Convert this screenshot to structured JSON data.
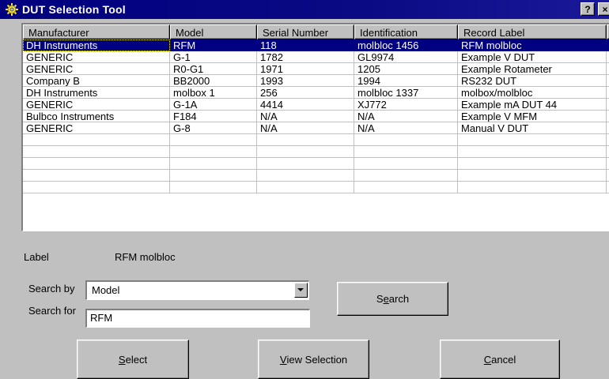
{
  "window": {
    "title": "DUT Selection Tool",
    "help_label": "?",
    "close_label": "×"
  },
  "table": {
    "columns": [
      "Manufacturer",
      "Model",
      "Serial Number",
      "Identification",
      "Record Label",
      ""
    ],
    "selected_index": 0,
    "rows": [
      [
        "DH Instruments",
        "RFM",
        "118",
        "molbloc 1456",
        "RFM molbloc"
      ],
      [
        "GENERIC",
        "G-1",
        "1782",
        "GL9974",
        "Example V DUT"
      ],
      [
        "GENERIC",
        "R0-G1",
        "1971",
        "1205",
        "Example Rotameter"
      ],
      [
        "Company B",
        "BB2000",
        "1993",
        "1994",
        "RS232 DUT"
      ],
      [
        "DH Instruments",
        "molbox 1",
        "256",
        "molbloc 1337",
        "molbox/molbloc"
      ],
      [
        "GENERIC",
        "G-1A",
        "4414",
        "XJ772",
        "Example mA DUT 44"
      ],
      [
        "Bulbco Instruments",
        "F184",
        "N/A",
        "N/A",
        "Example V MFM"
      ],
      [
        "GENERIC",
        "G-8",
        "N/A",
        "N/A",
        "Manual V DUT"
      ],
      [
        "",
        "",
        "",
        "",
        ""
      ],
      [
        "",
        "",
        "",
        "",
        ""
      ],
      [
        "",
        "",
        "",
        "",
        ""
      ],
      [
        "",
        "",
        "",
        "",
        ""
      ],
      [
        "",
        "",
        "",
        "",
        ""
      ]
    ]
  },
  "label": {
    "caption": "Label",
    "value": "RFM molbloc"
  },
  "search": {
    "by_label": "Search by",
    "by_value": "Model",
    "for_label": "Search for",
    "for_value": "RFM",
    "button_prefix": "S",
    "button_mnemonic": "e",
    "button_suffix": "arch"
  },
  "buttons": {
    "select_mnemonic": "S",
    "select_rest": "elect",
    "view_mnemonic": "V",
    "view_rest": "iew Selection",
    "cancel_mnemonic": "C",
    "cancel_rest": "ancel"
  }
}
